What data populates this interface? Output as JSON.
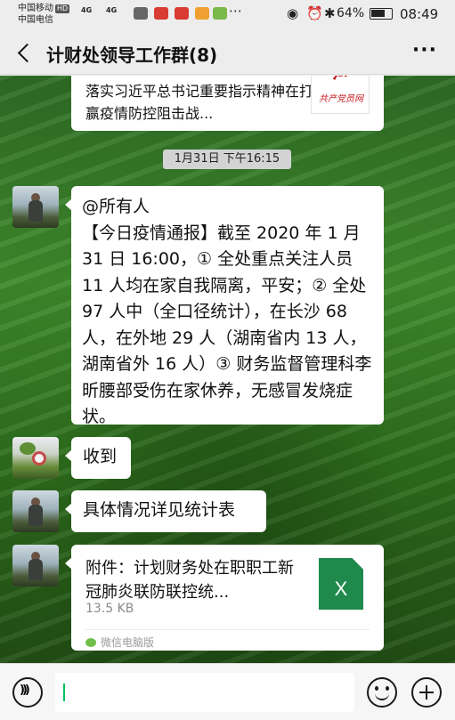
{
  "statusbar": {
    "carrier1": "中国移动",
    "hd": "HD",
    "carrier2": "中国电信",
    "signal1": "4G",
    "signal2": "4G",
    "battery": "64%",
    "time": "08:49"
  },
  "header": {
    "title": "计财处领导工作群(8)",
    "more": "···"
  },
  "messages": {
    "shared_article": {
      "text": "落实习近平总书记重要指示精神在打赢疫情防控阻击战...",
      "thumb_caption": "共产党员网"
    },
    "timestamp": "1月31日 下午16:15",
    "notice": "@所有人\n【今日疫情通报】截至 2020 年 1 月 31 日 16:00，① 全处重点关注人员 11 人均在家自我隔离，平安；② 全处 97 人中（全口径统计），在长沙 68 人，在外地 29 人（湖南省内 13 人，湖南省外 16 人）③ 财务监督管理科李昕腰部受伤在家休养，无感冒发烧症状。",
    "received": "收到",
    "details": "具体情况详见统计表",
    "attachment": {
      "name": "附件：计划财务处在职职工新冠肺炎联防联控统...",
      "size": "13.5 KB",
      "icon_letter": "X",
      "source": "微信电脑版"
    }
  },
  "colors": {
    "accent": "#07c160",
    "excel": "#1f8a4c",
    "party_red": "#c8171d"
  }
}
